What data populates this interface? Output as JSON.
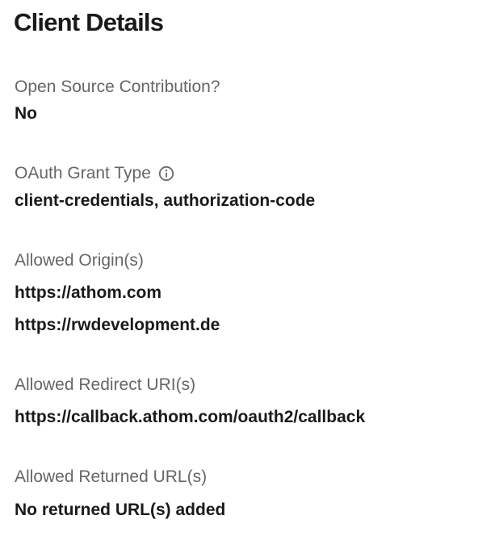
{
  "page": {
    "title": "Client Details"
  },
  "fields": {
    "open_source": {
      "label": "Open Source Contribution?",
      "value": "No"
    },
    "grant_type": {
      "label": "OAuth Grant Type",
      "info_icon": "info-icon",
      "value": "client-credentials, authorization-code"
    },
    "origins": {
      "label": "Allowed Origin(s)",
      "values": [
        "https://athom.com",
        "https://rwdevelopment.de"
      ]
    },
    "redirect_uris": {
      "label": "Allowed Redirect URI(s)",
      "values": [
        "https://callback.athom.com/oauth2/callback"
      ]
    },
    "returned_urls": {
      "label": "Allowed Returned URL(s)",
      "value": "No returned URL(s) added"
    }
  },
  "colors": {
    "label": "#666666",
    "value": "#1a1a1a",
    "background": "#ffffff"
  }
}
